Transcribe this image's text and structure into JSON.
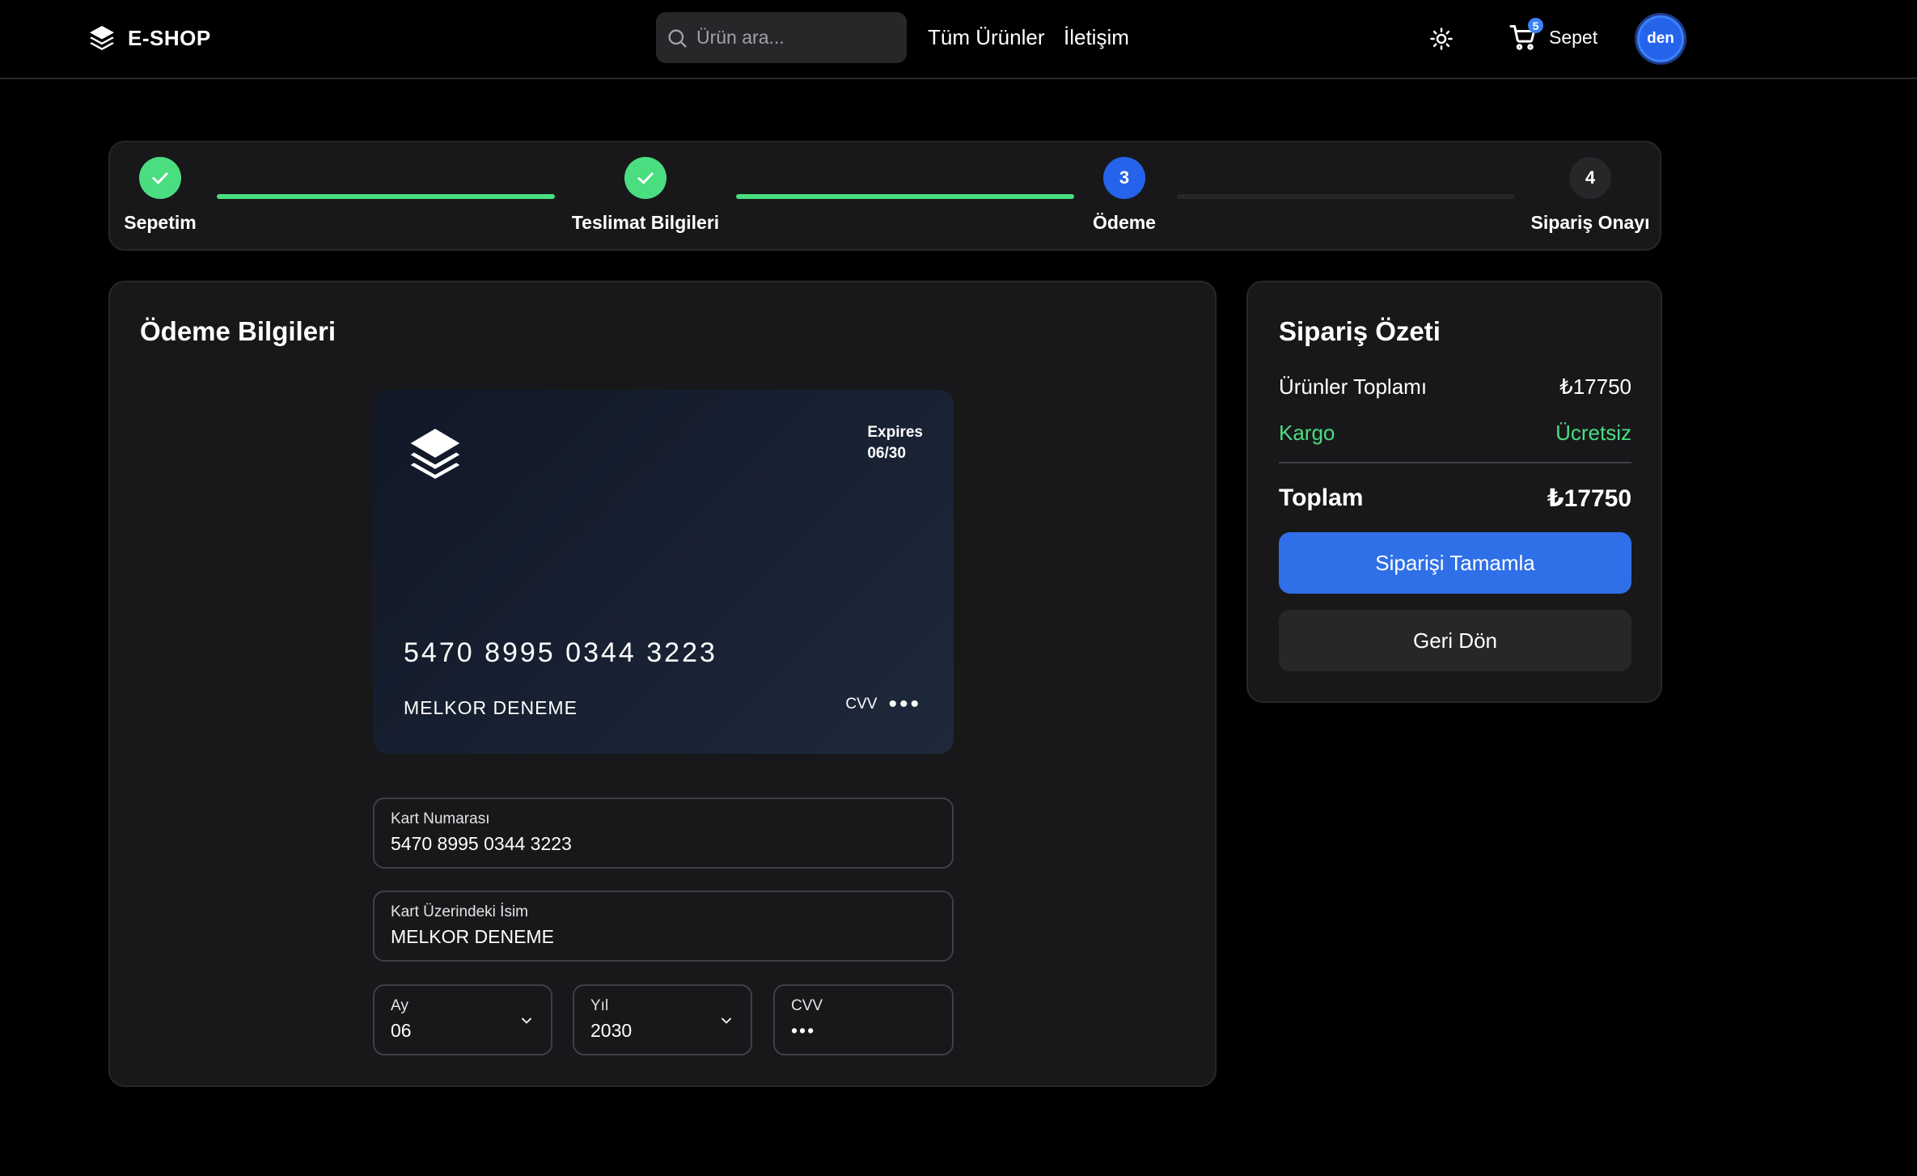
{
  "brand": {
    "name": "E-SHOP"
  },
  "search": {
    "placeholder": "Ürün ara..."
  },
  "nav": {
    "all_products": "Tüm Ürünler",
    "contact": "İletişim"
  },
  "cart": {
    "label": "Sepet",
    "count": "5"
  },
  "user": {
    "initials": "den"
  },
  "colors": {
    "accent": "#2563eb",
    "success": "#4ade80",
    "panel": "#18181b"
  },
  "steps": [
    {
      "label": "Sepetim",
      "state": "done",
      "icon": "check-icon"
    },
    {
      "label": "Teslimat Bilgileri",
      "state": "done",
      "icon": "check-icon"
    },
    {
      "label": "Ödeme",
      "number": "3",
      "state": "active"
    },
    {
      "label": "Sipariş Onayı",
      "number": "4",
      "state": "pending"
    }
  ],
  "payment": {
    "title": "Ödeme Bilgileri",
    "card": {
      "expires_label": "Expires",
      "expires_value": "06/30",
      "number": "5470 8995 0344 3223",
      "holder": "MELKOR DENEME",
      "cvv_label": "CVV",
      "cvv_mask": "•••"
    },
    "fields": {
      "card_number": {
        "label": "Kart Numarası",
        "value": "5470 8995 0344 3223"
      },
      "card_name": {
        "label": "Kart Üzerindeki İsim",
        "value": "MELKOR DENEME"
      },
      "month": {
        "label": "Ay",
        "value": "06"
      },
      "year": {
        "label": "Yıl",
        "value": "2030"
      },
      "cvv": {
        "label": "CVV",
        "value": "•••"
      }
    }
  },
  "summary": {
    "title": "Sipariş Özeti",
    "products_total_label": "Ürünler Toplamı",
    "products_total_value": "₺17750",
    "shipping_label": "Kargo",
    "shipping_value": "Ücretsiz",
    "total_label": "Toplam",
    "total_value": "₺17750",
    "complete_button": "Siparişi Tamamla",
    "back_button": "Geri Dön"
  }
}
